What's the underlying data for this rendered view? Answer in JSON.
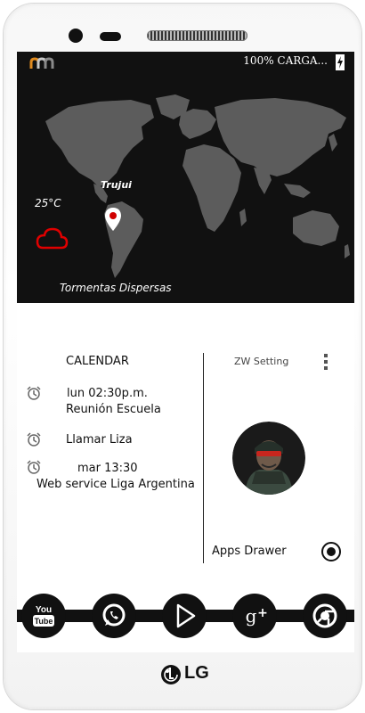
{
  "status_bar": {
    "logo_icon": "signal-logo-icon",
    "battery_text": "100% CARGA...",
    "battery_icon": "charging-battery-icon",
    "logo_colors": [
      "#e08a1e",
      "#8a8a8a"
    ]
  },
  "weather": {
    "city": "Trujui",
    "temperature": "25°C",
    "condition": "Tormentas Dispersas",
    "icon": "cloud-icon",
    "icon_color": "#e00000"
  },
  "calendar": {
    "title": "CALENDAR",
    "events": [
      {
        "time": "lun 02:30p.m.",
        "title": "Reunión Escuela",
        "icon": "alarm-clock-icon"
      },
      {
        "time": "",
        "title": "Llamar Liza",
        "icon": "alarm-clock-icon"
      },
      {
        "time": "mar 13:30",
        "title": "Web service Liga Argentina",
        "icon": "alarm-clock-icon"
      }
    ]
  },
  "widget": {
    "settings_label": "ZW Setting",
    "menu_icon": "more-vertical-icon",
    "avatar_icon": "soldier-avatar",
    "apps_drawer_label": "Apps Drawer",
    "apps_drawer_icon": "radio-button-icon"
  },
  "dock": [
    "youtube-icon",
    "whatsapp-icon",
    "play-store-icon",
    "google-plus-icon",
    "chrome-icon"
  ],
  "device": {
    "brand": "LG"
  }
}
